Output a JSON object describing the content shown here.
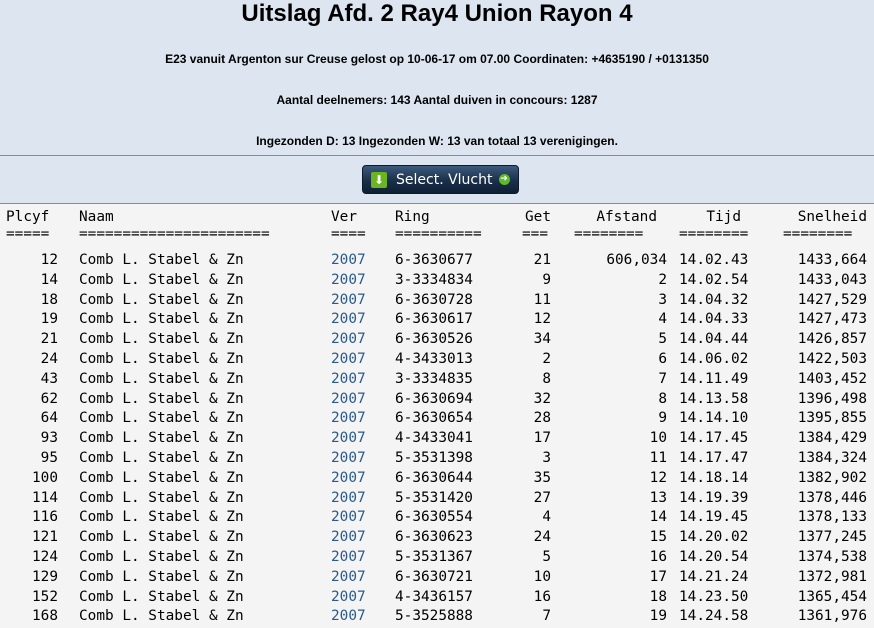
{
  "header": {
    "title": "Uitslag Afd. 2 Ray4 Union Rayon 4",
    "race_info": "E23 vanuit Argenton sur Creuse gelost op 10-06-17 om 07.00 Coordinaten: +4635190 / +0131350",
    "participants": "Aantal deelnemers: 143 Aantal duiven in concours: 1287",
    "submitted": "Ingezonden D: 13 Ingezonden W: 13 van totaal 13 verenigingen."
  },
  "toolbar": {
    "select_label": "Select. Vlucht",
    "select_icon": "download-icon",
    "arrow_icon": "arrow-right-icon",
    "button_color": "#1a2f49",
    "accent_green": "#6ab520"
  },
  "table": {
    "columns": {
      "plcyf": "Plcyf",
      "naam": "Naam",
      "ver": "Ver",
      "ring": "Ring",
      "get": "Get",
      "afstand": "Afstand",
      "tijd": "Tijd",
      "snelheid": "Snelheid"
    },
    "separators": {
      "plcyf": "=====",
      "naam": "======================",
      "ver": "====",
      "ring": "==========",
      "get": "===",
      "afstand": "========",
      "tijd": "========",
      "snelheid": "========"
    },
    "rows": [
      {
        "plcyf": "12",
        "naam": "Comb L. Stabel & Zn",
        "ver": "2007",
        "ring": "6-3630677",
        "get": "21",
        "afstand": "606,034",
        "tijd": "14.02.43",
        "snelheid": "1433,664"
      },
      {
        "plcyf": "14",
        "naam": "Comb L. Stabel & Zn",
        "ver": "2007",
        "ring": "3-3334834",
        "get": "9",
        "afstand": "2",
        "tijd": "14.02.54",
        "snelheid": "1433,043"
      },
      {
        "plcyf": "18",
        "naam": "Comb L. Stabel & Zn",
        "ver": "2007",
        "ring": "6-3630728",
        "get": "11",
        "afstand": "3",
        "tijd": "14.04.32",
        "snelheid": "1427,529"
      },
      {
        "plcyf": "19",
        "naam": "Comb L. Stabel & Zn",
        "ver": "2007",
        "ring": "6-3630617",
        "get": "12",
        "afstand": "4",
        "tijd": "14.04.33",
        "snelheid": "1427,473"
      },
      {
        "plcyf": "21",
        "naam": "Comb L. Stabel & Zn",
        "ver": "2007",
        "ring": "6-3630526",
        "get": "34",
        "afstand": "5",
        "tijd": "14.04.44",
        "snelheid": "1426,857"
      },
      {
        "plcyf": "24",
        "naam": "Comb L. Stabel & Zn",
        "ver": "2007",
        "ring": "4-3433013",
        "get": "2",
        "afstand": "6",
        "tijd": "14.06.02",
        "snelheid": "1422,503"
      },
      {
        "plcyf": "43",
        "naam": "Comb L. Stabel & Zn",
        "ver": "2007",
        "ring": "3-3334835",
        "get": "8",
        "afstand": "7",
        "tijd": "14.11.49",
        "snelheid": "1403,452"
      },
      {
        "plcyf": "62",
        "naam": "Comb L. Stabel & Zn",
        "ver": "2007",
        "ring": "6-3630694",
        "get": "32",
        "afstand": "8",
        "tijd": "14.13.58",
        "snelheid": "1396,498"
      },
      {
        "plcyf": "64",
        "naam": "Comb L. Stabel & Zn",
        "ver": "2007",
        "ring": "6-3630654",
        "get": "28",
        "afstand": "9",
        "tijd": "14.14.10",
        "snelheid": "1395,855"
      },
      {
        "plcyf": "93",
        "naam": "Comb L. Stabel & Zn",
        "ver": "2007",
        "ring": "4-3433041",
        "get": "17",
        "afstand": "10",
        "tijd": "14.17.45",
        "snelheid": "1384,429"
      },
      {
        "plcyf": "95",
        "naam": "Comb L. Stabel & Zn",
        "ver": "2007",
        "ring": "5-3531398",
        "get": "3",
        "afstand": "11",
        "tijd": "14.17.47",
        "snelheid": "1384,324"
      },
      {
        "plcyf": "100",
        "naam": "Comb L. Stabel & Zn",
        "ver": "2007",
        "ring": "6-3630644",
        "get": "35",
        "afstand": "12",
        "tijd": "14.18.14",
        "snelheid": "1382,902"
      },
      {
        "plcyf": "114",
        "naam": "Comb L. Stabel & Zn",
        "ver": "2007",
        "ring": "5-3531420",
        "get": "27",
        "afstand": "13",
        "tijd": "14.19.39",
        "snelheid": "1378,446"
      },
      {
        "plcyf": "116",
        "naam": "Comb L. Stabel & Zn",
        "ver": "2007",
        "ring": "6-3630554",
        "get": "4",
        "afstand": "14",
        "tijd": "14.19.45",
        "snelheid": "1378,133"
      },
      {
        "plcyf": "121",
        "naam": "Comb L. Stabel & Zn",
        "ver": "2007",
        "ring": "6-3630623",
        "get": "24",
        "afstand": "15",
        "tijd": "14.20.02",
        "snelheid": "1377,245"
      },
      {
        "plcyf": "124",
        "naam": "Comb L. Stabel & Zn",
        "ver": "2007",
        "ring": "5-3531367",
        "get": "5",
        "afstand": "16",
        "tijd": "14.20.54",
        "snelheid": "1374,538"
      },
      {
        "plcyf": "129",
        "naam": "Comb L. Stabel & Zn",
        "ver": "2007",
        "ring": "6-3630721",
        "get": "10",
        "afstand": "17",
        "tijd": "14.21.24",
        "snelheid": "1372,981"
      },
      {
        "plcyf": "152",
        "naam": "Comb L. Stabel & Zn",
        "ver": "2007",
        "ring": "4-3436157",
        "get": "16",
        "afstand": "18",
        "tijd": "14.23.50",
        "snelheid": "1365,454"
      },
      {
        "plcyf": "168",
        "naam": "Comb L. Stabel & Zn",
        "ver": "2007",
        "ring": "5-3525888",
        "get": "7",
        "afstand": "19",
        "tijd": "14.24.58",
        "snelheid": "1361,976"
      }
    ],
    "ver_link_color": "#2a5a8c"
  }
}
